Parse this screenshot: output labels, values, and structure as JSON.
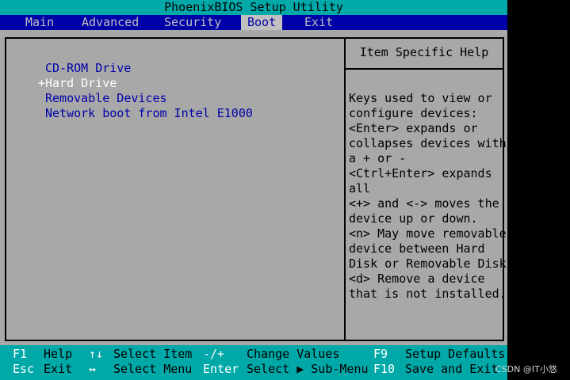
{
  "app": {
    "title": "PhoenixBIOS Setup Utility"
  },
  "menu": {
    "items": [
      {
        "label": "Main"
      },
      {
        "label": "Advanced"
      },
      {
        "label": "Security"
      },
      {
        "label": "Boot"
      },
      {
        "label": "Exit"
      }
    ],
    "active": "Boot"
  },
  "boot_list": {
    "items": [
      {
        "marker": "",
        "label": "CD-ROM Drive"
      },
      {
        "marker": "+",
        "label": "Hard Drive"
      },
      {
        "marker": "",
        "label": "Removable Devices"
      },
      {
        "marker": "",
        "label": "Network boot from Intel E1000"
      }
    ]
  },
  "help": {
    "title": "Item Specific Help",
    "lines": [
      "Keys used to view or",
      "configure devices:",
      "<Enter> expands or",
      "collapses devices with",
      "a + or -",
      "<Ctrl+Enter> expands",
      "all",
      "<+> and <-> moves the",
      "device up or down.",
      "<n> May move removable",
      "device between Hard",
      "Disk or Removable Disk",
      "<d> Remove a device",
      "that is not installed."
    ]
  },
  "status": {
    "row1": [
      {
        "key": "F1",
        "desc": "Help"
      },
      {
        "key": "↑↓",
        "desc": "Select Item"
      },
      {
        "key": "-/+",
        "desc": "Change Values"
      },
      {
        "key": "F9",
        "desc": "Setup Defaults"
      }
    ],
    "row2": [
      {
        "key": "Esc",
        "desc": "Exit"
      },
      {
        "key": "↔",
        "desc": "Select Menu"
      },
      {
        "key": "Enter",
        "desc": "Select ▶ Sub-Menu"
      },
      {
        "key": "F10",
        "desc": "Save and Exit"
      }
    ]
  },
  "watermark": "CSDN @IT小悠",
  "colors": {
    "title_bg": "#00a8a8",
    "menu_bg": "#0000a8",
    "panel_bg": "#a8a8a8",
    "item_text": "#0000a8",
    "selected_text": "#ffffff"
  }
}
